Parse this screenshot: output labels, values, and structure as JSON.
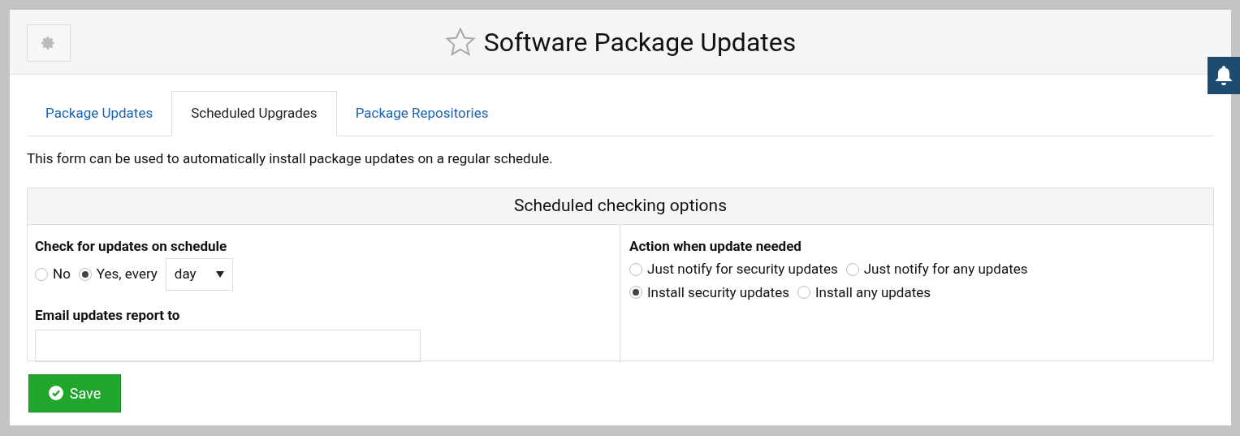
{
  "header": {
    "title": "Software Package Updates",
    "favorite": false
  },
  "tabs": [
    {
      "label": "Package Updates",
      "selected": false
    },
    {
      "label": "Scheduled Upgrades",
      "selected": true
    },
    {
      "label": "Package Repositories",
      "selected": false
    }
  ],
  "description": "This form can be used to automatically install package updates on a regular schedule.",
  "section": {
    "title": "Scheduled checking options",
    "schedule": {
      "label": "Check for updates on schedule",
      "options": [
        {
          "label": "No",
          "selected": false
        },
        {
          "label": "Yes, every",
          "selected": true
        }
      ],
      "interval": "day"
    },
    "email": {
      "label": "Email updates report to"
    },
    "action": {
      "label": "Action when update needed",
      "rows": [
        [
          {
            "label": "Just notify for security updates",
            "selected": false
          },
          {
            "label": "Just notify for any updates",
            "selected": false
          }
        ],
        [
          {
            "label": "Install security updates",
            "selected": true
          },
          {
            "label": "Install any updates",
            "selected": false
          }
        ]
      ]
    }
  },
  "save_button": "Save"
}
